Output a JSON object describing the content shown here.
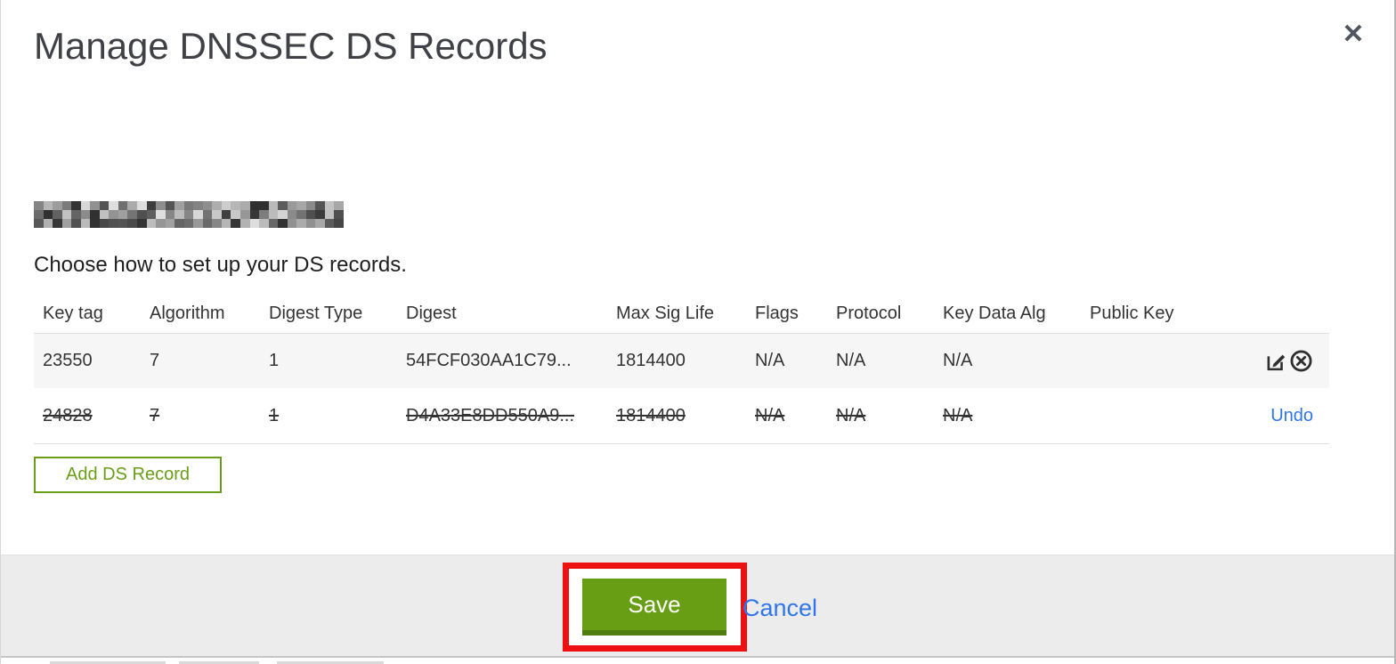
{
  "modal": {
    "title": "Manage DNSSEC DS Records",
    "close_glyph": "✕",
    "domain_redacted": true,
    "instruction": "Choose how to set up your DS records.",
    "table": {
      "columns": [
        "Key tag",
        "Algorithm",
        "Digest Type",
        "Digest",
        "Max Sig Life",
        "Flags",
        "Protocol",
        "Key Data Alg",
        "Public Key"
      ],
      "rows": [
        {
          "key_tag": "23550",
          "algorithm": "7",
          "digest_type": "1",
          "digest": "54FCF030AA1C79...",
          "max_sig_life": "1814400",
          "flags": "N/A",
          "protocol": "N/A",
          "key_data_alg": "N/A",
          "public_key": "",
          "state": "active",
          "actions": [
            "edit-icon",
            "delete-circle-icon"
          ]
        },
        {
          "key_tag": "24828",
          "algorithm": "7",
          "digest_type": "1",
          "digest": "D4A33E8DD550A9...",
          "max_sig_life": "1814400",
          "flags": "N/A",
          "protocol": "N/A",
          "key_data_alg": "N/A",
          "public_key": "",
          "state": "deleted",
          "undo_label": "Undo"
        }
      ]
    },
    "add_button_label": "Add DS Record",
    "footer": {
      "save_label": "Save",
      "cancel_label": "Cancel"
    },
    "colors": {
      "accent_green": "#689e14",
      "accent_green_dark": "#517c10",
      "outline_green": "#6a9e19",
      "link_blue": "#2f76e8",
      "annotation_red": "#ee1111",
      "footer_gray": "#ececec",
      "row_stripe": "#f6f6f6"
    }
  }
}
